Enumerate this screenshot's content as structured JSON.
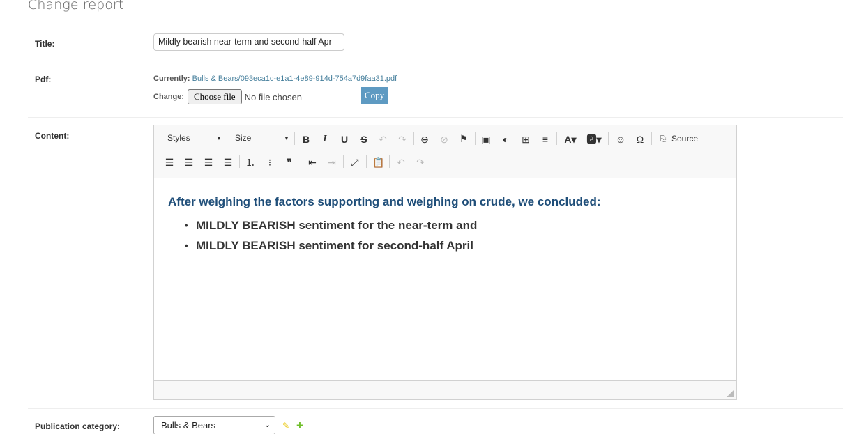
{
  "page": {
    "heading": "Change report"
  },
  "title_field": {
    "label": "Title:",
    "value": "Mildly bearish near-term and second-half Apr"
  },
  "pdf_field": {
    "label": "Pdf:",
    "currently_label": "Currently:",
    "file_link": "Bulls & Bears/093eca1c-e1a1-4e89-914d-754a7d9faa31.pdf",
    "change_label": "Change:",
    "choose_button": "Choose file",
    "no_file_text": "No file chosen",
    "copy_button": "Copy"
  },
  "content_field": {
    "label": "Content:",
    "toolbar": {
      "styles_combo": "Styles",
      "size_combo": "Size",
      "source_label": "Source"
    },
    "body": {
      "heading": "After weighing the factors supporting and weighing on crude, we concluded:",
      "bullets": [
        "MILDLY BEARISH sentiment for the near-term and",
        "MILDLY BEARISH sentiment for second-half April"
      ]
    }
  },
  "category_field": {
    "label": "Publication category:",
    "selected": "Bulls & Bears"
  }
}
